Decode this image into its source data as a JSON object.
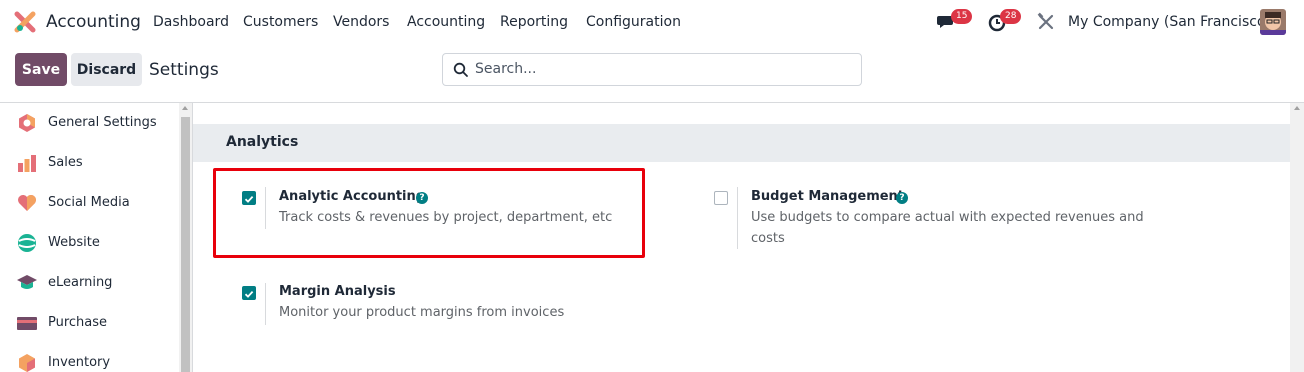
{
  "navbar": {
    "app_name": "Accounting",
    "menu": [
      "Dashboard",
      "Customers",
      "Vendors",
      "Accounting",
      "Reporting",
      "Configuration"
    ],
    "messages_badge": "15",
    "activities_badge": "28",
    "company": "My Company (San Francisco)"
  },
  "control": {
    "save_label": "Save",
    "discard_label": "Discard",
    "title": "Settings",
    "search_placeholder": "Search..."
  },
  "sidebar": {
    "items": [
      {
        "label": "General Settings",
        "icon": "general-settings-icon"
      },
      {
        "label": "Sales",
        "icon": "sales-icon"
      },
      {
        "label": "Social Media",
        "icon": "social-media-icon"
      },
      {
        "label": "Website",
        "icon": "website-icon"
      },
      {
        "label": "eLearning",
        "icon": "elearning-icon"
      },
      {
        "label": "Purchase",
        "icon": "purchase-icon"
      },
      {
        "label": "Inventory",
        "icon": "inventory-icon"
      }
    ]
  },
  "section": {
    "title": "Analytics",
    "settings": [
      {
        "title": "Analytic Accounting",
        "desc": "Track costs & revenues by project, department, etc",
        "checked": true
      },
      {
        "title": "Budget Management",
        "desc_line1": "Use budgets to compare actual with expected revenues and",
        "desc_line2": "costs",
        "checked": false
      },
      {
        "title": "Margin Analysis",
        "desc": "Monitor your product margins from invoices",
        "checked": true
      }
    ]
  },
  "colors": {
    "brand": "#714b67",
    "accent": "#017e84",
    "highlight": "#e8000b"
  }
}
